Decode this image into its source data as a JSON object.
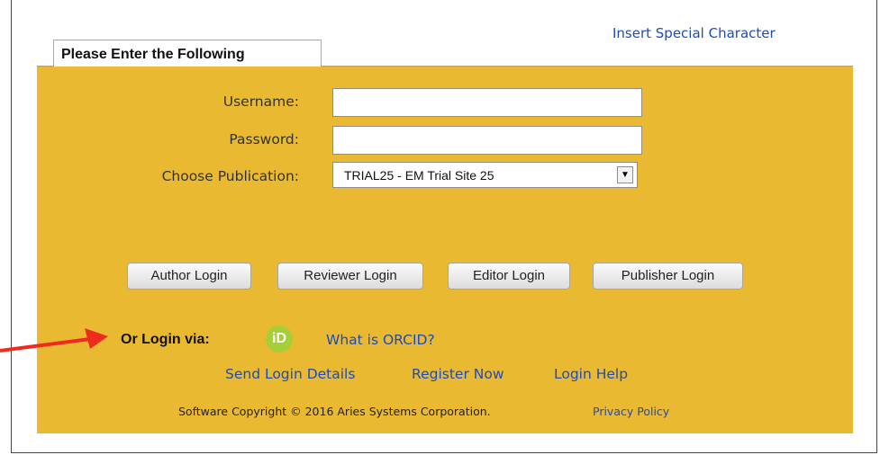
{
  "header": {
    "special_char_link": "Insert Special Character"
  },
  "form": {
    "tab_title": "Please Enter the Following",
    "username_label": "Username:",
    "username_value": "",
    "password_label": "Password:",
    "password_value": "",
    "publication_label": "Choose Publication:",
    "publication_selected": "TRIAL25 - EM Trial Site 25",
    "dropdown_arrow_glyph": "▼"
  },
  "buttons": {
    "author": "Author Login",
    "reviewer": "Reviewer Login",
    "editor": "Editor Login",
    "publisher": "Publisher Login"
  },
  "orcid": {
    "or_login_label": "Or Login via:",
    "icon_text": "iD",
    "what_is_link": "What is ORCID?"
  },
  "links": {
    "send_login_details": "Send Login Details",
    "register_now": "Register Now",
    "login_help": "Login Help"
  },
  "footer": {
    "copyright": "Software Copyright © 2016 Aries Systems Corporation.",
    "privacy_policy": "Privacy Policy"
  },
  "colors": {
    "panel": "#e9b932",
    "link": "#1f4bb8",
    "orcid": "#a6ce39",
    "annotation_arrow": "#ee2b1e"
  }
}
